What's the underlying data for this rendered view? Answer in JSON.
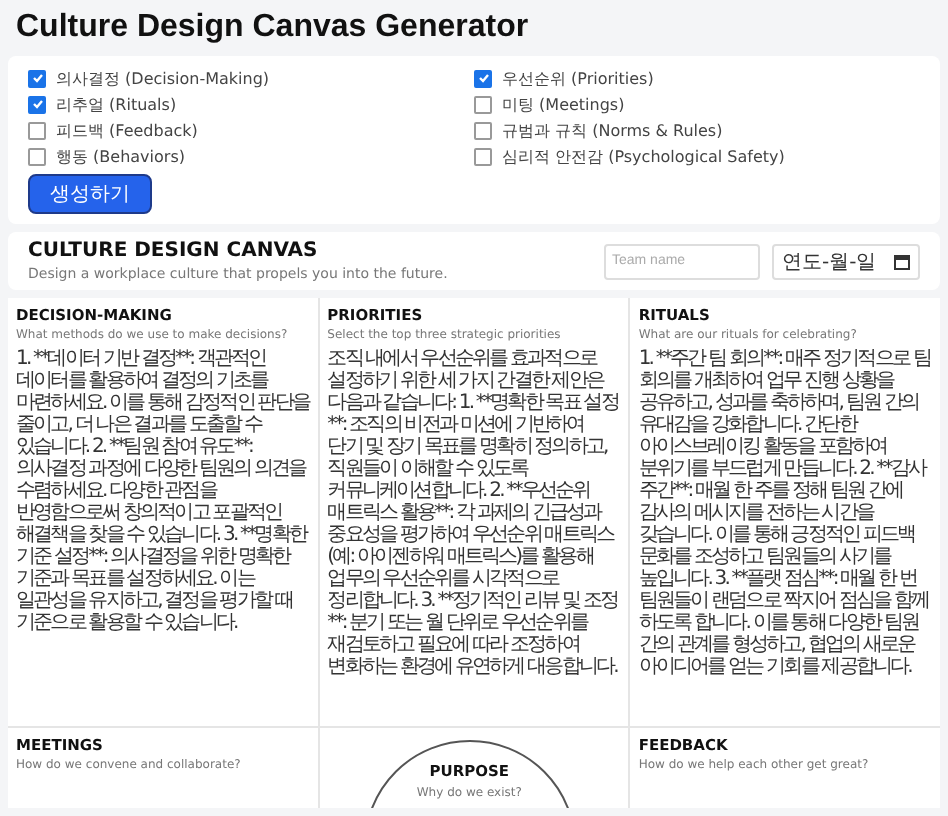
{
  "title": "Culture Design Canvas Generator",
  "options": [
    {
      "label": "의사결정 (Decision-Making)",
      "checked": true
    },
    {
      "label": "리추얼 (Rituals)",
      "checked": true
    },
    {
      "label": "피드백 (Feedback)",
      "checked": false
    },
    {
      "label": "행동 (Behaviors)",
      "checked": false
    },
    {
      "label": "우선순위 (Priorities)",
      "checked": true
    },
    {
      "label": "미팅 (Meetings)",
      "checked": false
    },
    {
      "label": "규범과 규칙 (Norms & Rules)",
      "checked": false
    },
    {
      "label": "심리적 안전감 (Psychological Safety)",
      "checked": false
    }
  ],
  "generate_button": "생성하기",
  "canvas": {
    "title": "CULTURE DESIGN CANVAS",
    "subtitle": "Design a workplace culture that propels you into the future.",
    "team_field": {
      "placeholder": "Team name"
    },
    "date_field": {
      "placeholder": "연도-월-일"
    },
    "sections": [
      {
        "kind": "section",
        "title": "DECISION-MAKING",
        "question": "What methods do we use to make decisions?",
        "body": "1. **데이터 기반 결정**: 객관적인 데이터를 활용하여 결정의 기초를 마련하세요. 이를 통해 감정적인 판단을 줄이고, 더 나은 결과를 도출할 수 있습니다. 2. **팀원 참여 유도**: 의사결정 과정에 다양한 팀원의 의견을 수렴하세요. 다양한 관점을 반영함으로써 창의적이고 포괄적인 해결책을 찾을 수 있습니다. 3. **명확한 기준 설정**: 의사결정을 위한 명확한 기준과 목표를 설정하세요. 이는 일관성을 유지하고, 결정을 평가할 때 기준으로 활용할 수 있습니다."
      },
      {
        "kind": "section",
        "title": "PRIORITIES",
        "question": "Select the top three strategic priorities",
        "body": "조직 내에서 우선순위를 효과적으로 설정하기 위한 세 가지 간결한 제안은 다음과 같습니다: 1. **명확한 목표 설정**: 조직의 비전과 미션에 기반하여 단기 및 장기 목표를 명확히 정의하고, 직원들이 이해할 수 있도록 커뮤니케이션합니다. 2. **우선순위 매트릭스 활용**: 각 과제의 긴급성과 중요성을 평가하여 우선순위 매트릭스(예: 아이젠하워 매트릭스)를 활용해 업무의 우선순위를 시각적으로 정리합니다. 3. **정기적인 리뷰 및 조정**: 분기 또는 월 단위로 우선순위를 재검토하고 필요에 따라 조정하여 변화하는 환경에 유연하게 대응합니다."
      },
      {
        "kind": "section",
        "title": "RITUALS",
        "question": "What are our rituals for celebrating?",
        "body": "1. **주간 팀 회의**: 매주 정기적으로 팀 회의를 개최하여 업무 진행 상황을 공유하고, 성과를 축하하며, 팀원 간의 유대감을 강화합니다. 간단한 아이스브레이킹 활동을 포함하여 분위기를 부드럽게 만듭니다. 2. **감사 주간**: 매월 한 주를 정해 팀원 간에 감사의 메시지를 전하는 시간을 갖습니다. 이를 통해 긍정적인 피드백 문화를 조성하고 팀원들의 사기를 높입니다. 3. **플랫 점심**: 매월 한 번 팀원들이 랜덤으로 짝지어 점심을 함께 하도록 합니다. 이를 통해 다양한 팀원 간의 관계를 형성하고, 협업의 새로운 아이디어를 얻는 기회를 제공합니다."
      },
      {
        "kind": "section",
        "title": "MEETINGS",
        "question": "How do we convene and collaborate?"
      },
      {
        "kind": "purpose",
        "title": "PURPOSE",
        "question": "Why do we exist?"
      },
      {
        "kind": "section",
        "title": "FEEDBACK",
        "question": "How do we help each other get great?"
      }
    ]
  }
}
